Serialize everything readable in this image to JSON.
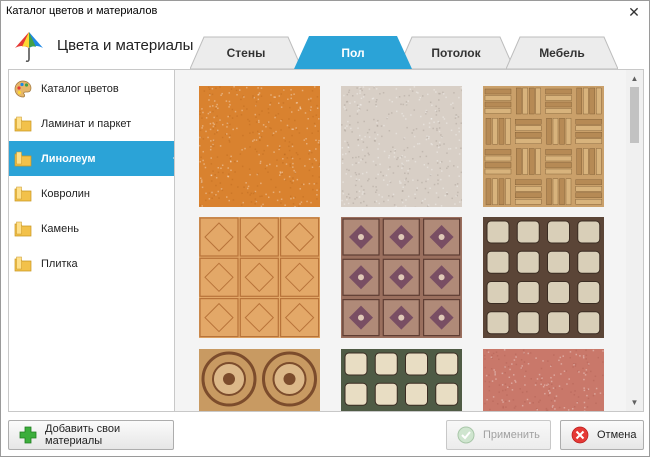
{
  "window": {
    "title": "Каталог цветов и материалов",
    "close_glyph": "✕"
  },
  "header": {
    "title": "Цвета и материалы",
    "logo_icon": "color-umbrella-icon"
  },
  "tabs": [
    {
      "label": "Стены",
      "active": false
    },
    {
      "label": "Пол",
      "active": true
    },
    {
      "label": "Потолок",
      "active": false
    },
    {
      "label": "Мебель",
      "active": false
    }
  ],
  "sidebar": {
    "items": [
      {
        "label": "Каталог цветов",
        "icon": "palette-icon",
        "active": false
      },
      {
        "label": "Ламинат и паркет",
        "icon": "folder-icon",
        "active": false
      },
      {
        "label": "Линолеум",
        "icon": "folder-icon",
        "active": true
      },
      {
        "label": "Ковролин",
        "icon": "folder-icon",
        "active": false
      },
      {
        "label": "Камень",
        "icon": "folder-icon",
        "active": false
      },
      {
        "label": "Плитка",
        "icon": "folder-icon",
        "active": false
      }
    ]
  },
  "materials": [
    {
      "name": "orange-cork",
      "pattern": "speckle",
      "base": "#d9822f",
      "accent": "#b5651d"
    },
    {
      "name": "beige-granite",
      "pattern": "speckle",
      "base": "#d8cfc6",
      "accent": "#9c8f86"
    },
    {
      "name": "wood-parquet",
      "pattern": "parquet",
      "base": "#caa06a",
      "accent": "#7a5a34"
    },
    {
      "name": "orange-tile-star",
      "pattern": "tile-star",
      "base": "#e3a868",
      "accent": "#b8733a"
    },
    {
      "name": "brown-ornament",
      "pattern": "ornament",
      "base": "#9a6f5e",
      "accent": "#6b3f5e"
    },
    {
      "name": "brown-square-tiles",
      "pattern": "squares",
      "base": "#5b4537",
      "accent": "#d9cfb8"
    },
    {
      "name": "circle-mosaic",
      "pattern": "circles",
      "base": "#c89a62",
      "accent": "#7c4c2c"
    },
    {
      "name": "green-square-tiles",
      "pattern": "squares",
      "base": "#4f5b45",
      "accent": "#e8ddc3"
    },
    {
      "name": "red-speckle",
      "pattern": "speckle",
      "base": "#c9786a",
      "accent": "#a85a4e"
    }
  ],
  "scrollbar": {
    "up_glyph": "▲",
    "down_glyph": "▼",
    "position": 0
  },
  "footer": {
    "add_label": "Добавить свои материалы",
    "apply_label": "Применить",
    "cancel_label": "Отмена"
  },
  "colors": {
    "accent": "#2ba3d7",
    "tab_inactive": "#ececec",
    "panel_bg": "#f4f4f4"
  }
}
